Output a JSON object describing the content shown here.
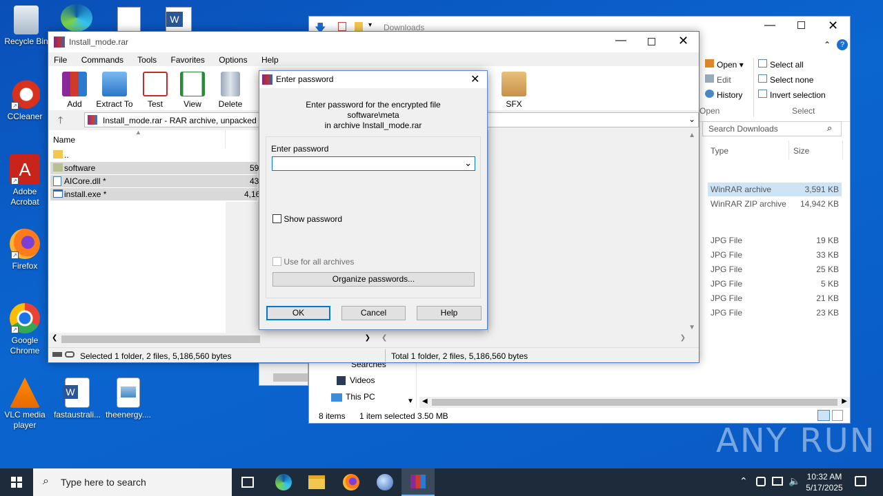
{
  "desktop": {
    "icons": [
      {
        "label": "Recycle Bin"
      },
      {
        "label": "CCleaner"
      },
      {
        "label": "Adobe Acrobat"
      },
      {
        "label": "Firefox"
      },
      {
        "label": "Google Chrome"
      },
      {
        "label": "VLC media player"
      },
      {
        "label": "fastaustrali..."
      },
      {
        "label": "theenergy...."
      }
    ]
  },
  "explorer": {
    "title": "Downloads",
    "ribbon": {
      "open_label": "Open",
      "edit_label": "Edit",
      "history_label": "History",
      "open_group": "Open",
      "select_all": "Select all",
      "select_none": "Select none",
      "invert_selection": "Invert selection",
      "select_group": "Select"
    },
    "search_placeholder": "Search Downloads",
    "columns": {
      "type": "Type",
      "size": "Size"
    },
    "rows": [
      {
        "type": "WinRAR archive",
        "size": "3,591 KB",
        "selected": true
      },
      {
        "type": "WinRAR ZIP archive",
        "size": "14,942 KB"
      },
      {
        "type": "JPG File",
        "size": "19 KB"
      },
      {
        "type": "JPG File",
        "size": "33 KB"
      },
      {
        "type": "JPG File",
        "size": "25 KB"
      },
      {
        "type": "JPG File",
        "size": "5 KB"
      },
      {
        "type": "JPG File",
        "size": "21 KB"
      },
      {
        "type": "JPG File",
        "size": "23 KB"
      }
    ],
    "nav": {
      "searches": "Searches",
      "videos": "Videos",
      "this_pc": "This PC"
    },
    "status": {
      "items": "8 items",
      "selected": "1 item selected",
      "size": "3.50 MB"
    }
  },
  "winrar": {
    "title": "Install_mode.rar",
    "menu": [
      "File",
      "Commands",
      "Tools",
      "Favorites",
      "Options",
      "Help"
    ],
    "toolbar": {
      "add": "Add",
      "extract_to": "Extract To",
      "test": "Test",
      "view": "View",
      "delete": "Delete",
      "sfx": "SFX"
    },
    "address": "Install_mode.rar - RAR archive, unpacked si",
    "columns": {
      "name": "Name"
    },
    "files": [
      {
        "name": "..",
        "size": ""
      },
      {
        "name": "software",
        "size": "59"
      },
      {
        "name": "AICore.dll *",
        "size": "43"
      },
      {
        "name": "install.exe *",
        "size": "4,16"
      }
    ],
    "status_left": "Selected 1 folder, 2 files, 5,186,560 bytes",
    "status_right": "Total 1 folder, 2 files, 5,186,560 bytes"
  },
  "dialog": {
    "title": "Enter password",
    "message_line1": "Enter password for the encrypted file",
    "message_line2": "software\\meta",
    "message_line3": "in archive Install_mode.rar",
    "field_label": "Enter password",
    "password_value": "",
    "show_password": "Show password",
    "use_for_all": "Use for all archives",
    "organize": "Organize passwords...",
    "ok": "OK",
    "cancel": "Cancel",
    "help": "Help"
  },
  "taskbar": {
    "search_placeholder": "Type here to search",
    "time": "10:32 AM",
    "date": "5/17/2025"
  },
  "watermark": "ANY RUN",
  "colors": {
    "desktop": "#0b66d0",
    "selection": "#cde4f7",
    "accent": "#0078d7"
  }
}
